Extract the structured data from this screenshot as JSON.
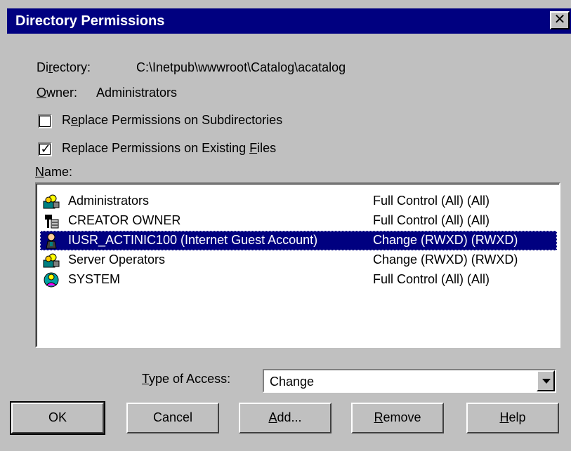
{
  "window": {
    "title": "Directory Permissions",
    "close_glyph": "✕"
  },
  "directory": {
    "label_pre": "Di",
    "label_ul": "r",
    "label_post": "ectory:",
    "value": "C:\\Inetpub\\wwwroot\\Catalog\\acatalog"
  },
  "owner": {
    "label_ul": "O",
    "label_post": "wner:",
    "value": "Administrators"
  },
  "checkboxes": [
    {
      "pre": "R",
      "ul": "e",
      "post": "place Permissions on Subdirectories",
      "checked": false,
      "mark": ""
    },
    {
      "pre": "Replace Permissions on Existing ",
      "ul": "F",
      "post": "iles",
      "checked": true,
      "mark": "✓"
    }
  ],
  "name_label": {
    "ul": "N",
    "post": "ame:"
  },
  "list": {
    "rows": [
      {
        "name": "Administrators",
        "access": "Full Control (All) (All)",
        "icon": "group-icon",
        "selected": false
      },
      {
        "name": "CREATOR OWNER",
        "access": "Full Control (All) (All)",
        "icon": "creator-owner-icon",
        "selected": false
      },
      {
        "name": "IUSR_ACTINIC100 (Internet Guest Account)",
        "access": "Change (RWXD) (RWXD)",
        "icon": "user-icon",
        "selected": true
      },
      {
        "name": "Server Operators",
        "access": "Change (RWXD) (RWXD)",
        "icon": "group-icon",
        "selected": false
      },
      {
        "name": "SYSTEM",
        "access": "Full Control (All) (All)",
        "icon": "system-icon",
        "selected": false
      }
    ]
  },
  "type_of_access": {
    "label_ul": "T",
    "label_post": "ype of Access:",
    "value": "Change"
  },
  "buttons": {
    "ok": "OK",
    "cancel": "Cancel",
    "add_ul": "A",
    "add_post": "dd...",
    "remove_ul": "R",
    "remove_post": "emove",
    "help_ul": "H",
    "help_post": "elp"
  }
}
